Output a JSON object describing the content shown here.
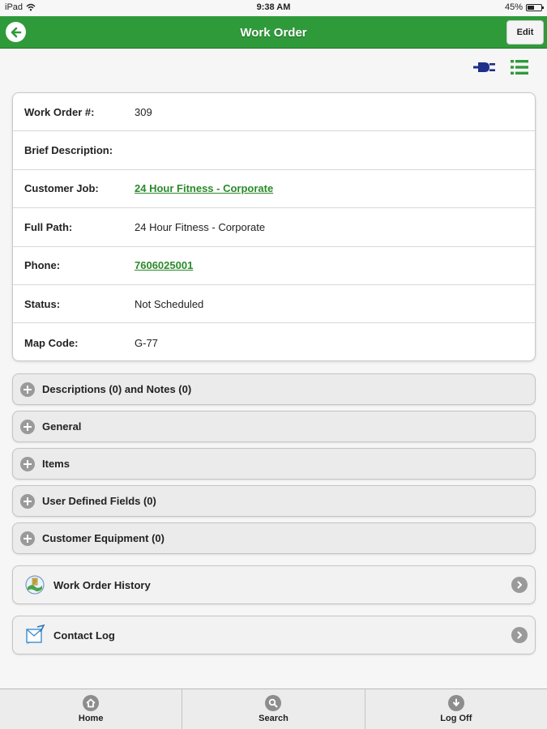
{
  "status_bar": {
    "device": "iPad",
    "time": "9:38 AM",
    "battery": "45%"
  },
  "header": {
    "title": "Work Order",
    "edit_label": "Edit",
    "back_icon": "back-arrow-icon"
  },
  "toolbar_icons": [
    "plug-icon",
    "list-icon"
  ],
  "colors": {
    "header": "#2f9a3a",
    "link": "#2a8a2a",
    "plug": "#1f2f8c",
    "list": "#2f9a3a"
  },
  "details": [
    {
      "label": "Work Order #:",
      "value": "309",
      "link": false
    },
    {
      "label": "Brief Description:",
      "value": "",
      "link": false
    },
    {
      "label": "Customer Job:",
      "value": "24 Hour Fitness - Corporate",
      "link": true
    },
    {
      "label": "Full Path:",
      "value": "24 Hour Fitness - Corporate",
      "link": false
    },
    {
      "label": "Phone:",
      "value": "7606025001",
      "link": true
    },
    {
      "label": "Status:",
      "value": "Not Scheduled",
      "link": false
    },
    {
      "label": "Map Code:",
      "value": "G-77",
      "link": false
    }
  ],
  "sections": [
    "Descriptions (0) and Notes (0)",
    "General",
    "Items",
    "User Defined Fields (0)",
    "Customer Equipment (0)"
  ],
  "link_rows": [
    {
      "label": "Work Order History",
      "icon": "history-globe-icon"
    },
    {
      "label": "Contact Log",
      "icon": "contact-log-icon"
    }
  ],
  "footer_tabs": [
    {
      "label": "Home",
      "icon": "home-icon"
    },
    {
      "label": "Search",
      "icon": "search-icon"
    },
    {
      "label": "Log Off",
      "icon": "log-off-icon"
    }
  ]
}
